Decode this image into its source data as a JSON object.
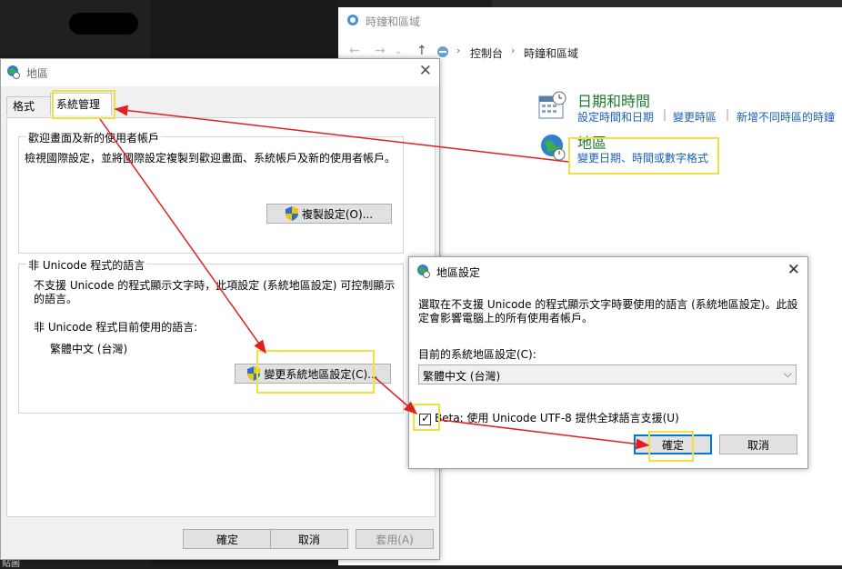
{
  "control_panel": {
    "title": "時鐘和區域",
    "breadcrumb": [
      "控制台",
      "時鐘和區域"
    ],
    "categories": [
      {
        "title": "日期和時間",
        "links": [
          "設定時間和日期",
          "變更時區",
          "新增不同時區的時鐘"
        ]
      },
      {
        "title": "地區",
        "links": [
          "變更日期、時間或數字格式"
        ]
      }
    ]
  },
  "region_dialog": {
    "title": "地區",
    "tabs": [
      "格式",
      "系統管理"
    ],
    "welcome_group": {
      "title": "歡迎畫面及新的使用者帳戶",
      "description": "檢視國際設定，並將國際設定複製到歡迎畫面、系統帳戶及新的使用者帳戶。",
      "copy_button": "複製設定(O)..."
    },
    "unicode_group": {
      "title": "非 Unicode 程式的語言",
      "description": "不支援 Unicode 的程式顯示文字時，此項設定 (系統地區設定) 可控制顯示的語言。",
      "current_label": "非 Unicode 程式目前使用的語言:",
      "current_value": "繁體中文 (台灣)",
      "change_button": "變更系統地區設定(C)..."
    },
    "buttons": {
      "ok": "確定",
      "cancel": "取消",
      "apply": "套用(A)"
    }
  },
  "locale_dialog": {
    "title": "地區設定",
    "description": "選取在不支援 Unicode 的程式顯示文字時要使用的語言 (系統地區設定)。此設定會影響電腦上的所有使用者帳戶。",
    "current_label": "目前的系統地區設定(C):",
    "current_value": "繁體中文 (台灣)",
    "beta_checkbox": {
      "label": "Beta: 使用 Unicode UTF-8 提供全球語言支援(U)",
      "checked": true
    },
    "buttons": {
      "ok": "確定",
      "cancel": "取消"
    }
  },
  "background": {
    "bottom_text": "貼圖"
  },
  "colors": {
    "highlight": "#f0e040",
    "arrow": "#e02020",
    "link": "#1a5fb4",
    "category": "#1e7a34",
    "accent": "#0078d7"
  }
}
